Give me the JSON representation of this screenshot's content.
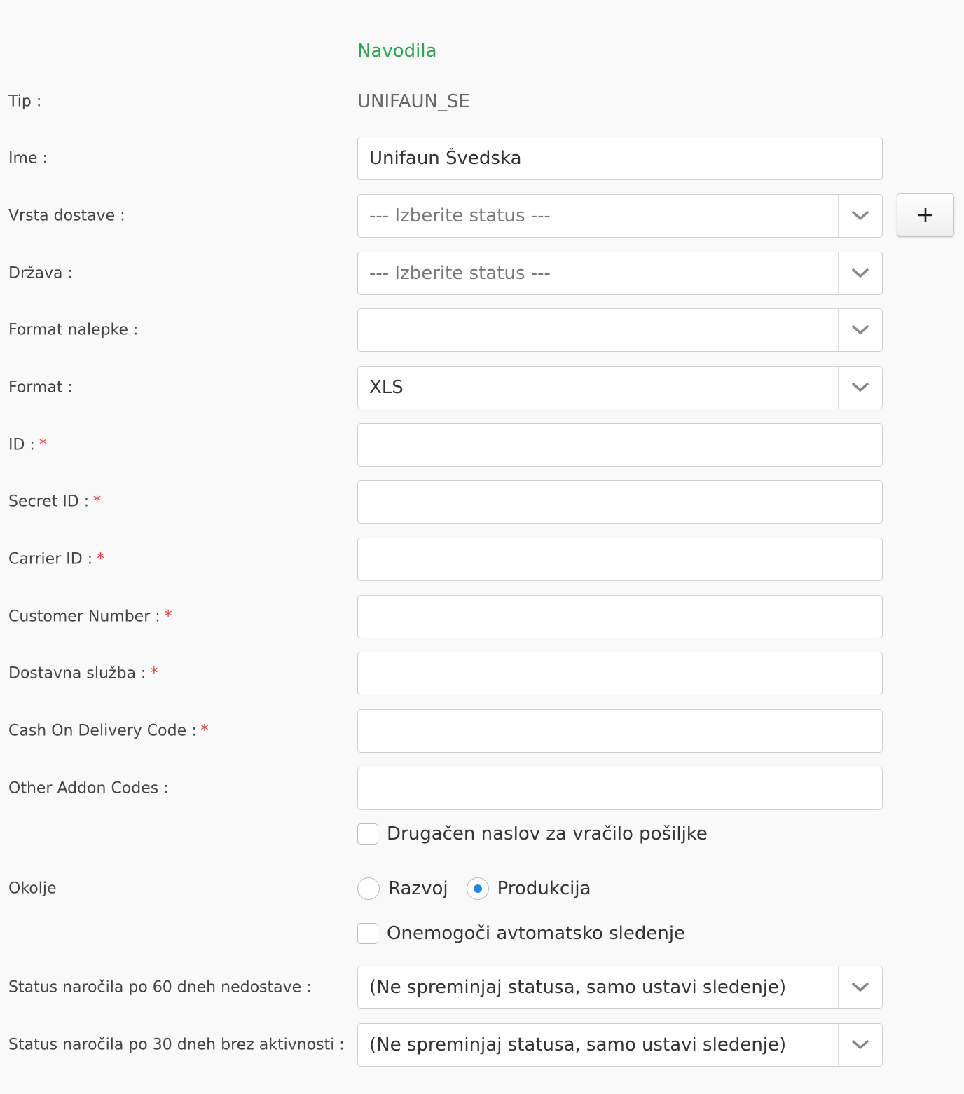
{
  "help_link": "Navodila",
  "fields": {
    "tip": {
      "label": "Tip :",
      "value": "UNIFAUN_SE"
    },
    "ime": {
      "label": "Ime :",
      "value": "Unifaun Švedska"
    },
    "vrsta_dostave": {
      "label": "Vrsta dostave :",
      "value": "--- Izberite status ---"
    },
    "drzava": {
      "label": "Država :",
      "value": "--- Izberite status ---"
    },
    "format_nalepke": {
      "label": "Format nalepke :",
      "value": ""
    },
    "format": {
      "label": "Format :",
      "value": "XLS"
    },
    "id": {
      "label": "ID :",
      "required": "*",
      "value": ""
    },
    "secret_id": {
      "label": "Secret ID :",
      "required": "*",
      "value": ""
    },
    "carrier_id": {
      "label": "Carrier ID :",
      "required": "*",
      "value": ""
    },
    "customer_number": {
      "label": "Customer Number :",
      "required": "*",
      "value": ""
    },
    "dostavna_sluzba": {
      "label": "Dostavna služba :",
      "required": "*",
      "value": ""
    },
    "cod_code": {
      "label": "Cash On Delivery Code :",
      "required": "*",
      "value": ""
    },
    "other_addon_codes": {
      "label": "Other Addon Codes :",
      "value": ""
    },
    "status_60": {
      "label": "Status naročila po 60 dneh nedostave :",
      "value": "(Ne spreminjaj statusa, samo ustavi sledenje)"
    },
    "status_30": {
      "label": "Status naročila po 30 dneh brez aktivnosti :",
      "value": "(Ne spreminjaj statusa, samo ustavi sledenje)"
    }
  },
  "add_button_label": "+",
  "checkbox_return_address": {
    "label": "Drugačen naslov za vračilo pošiljke",
    "checked": false
  },
  "environment": {
    "label": "Okolje",
    "options": [
      {
        "label": "Razvoj",
        "selected": false
      },
      {
        "label": "Produkcija",
        "selected": true
      }
    ]
  },
  "checkbox_disable_tracking": {
    "label": "Onemogoči avtomatsko sledenje",
    "checked": false
  },
  "colors": {
    "accent": "#1e88e5",
    "link": "#2ea44f",
    "required": "#e53935"
  }
}
